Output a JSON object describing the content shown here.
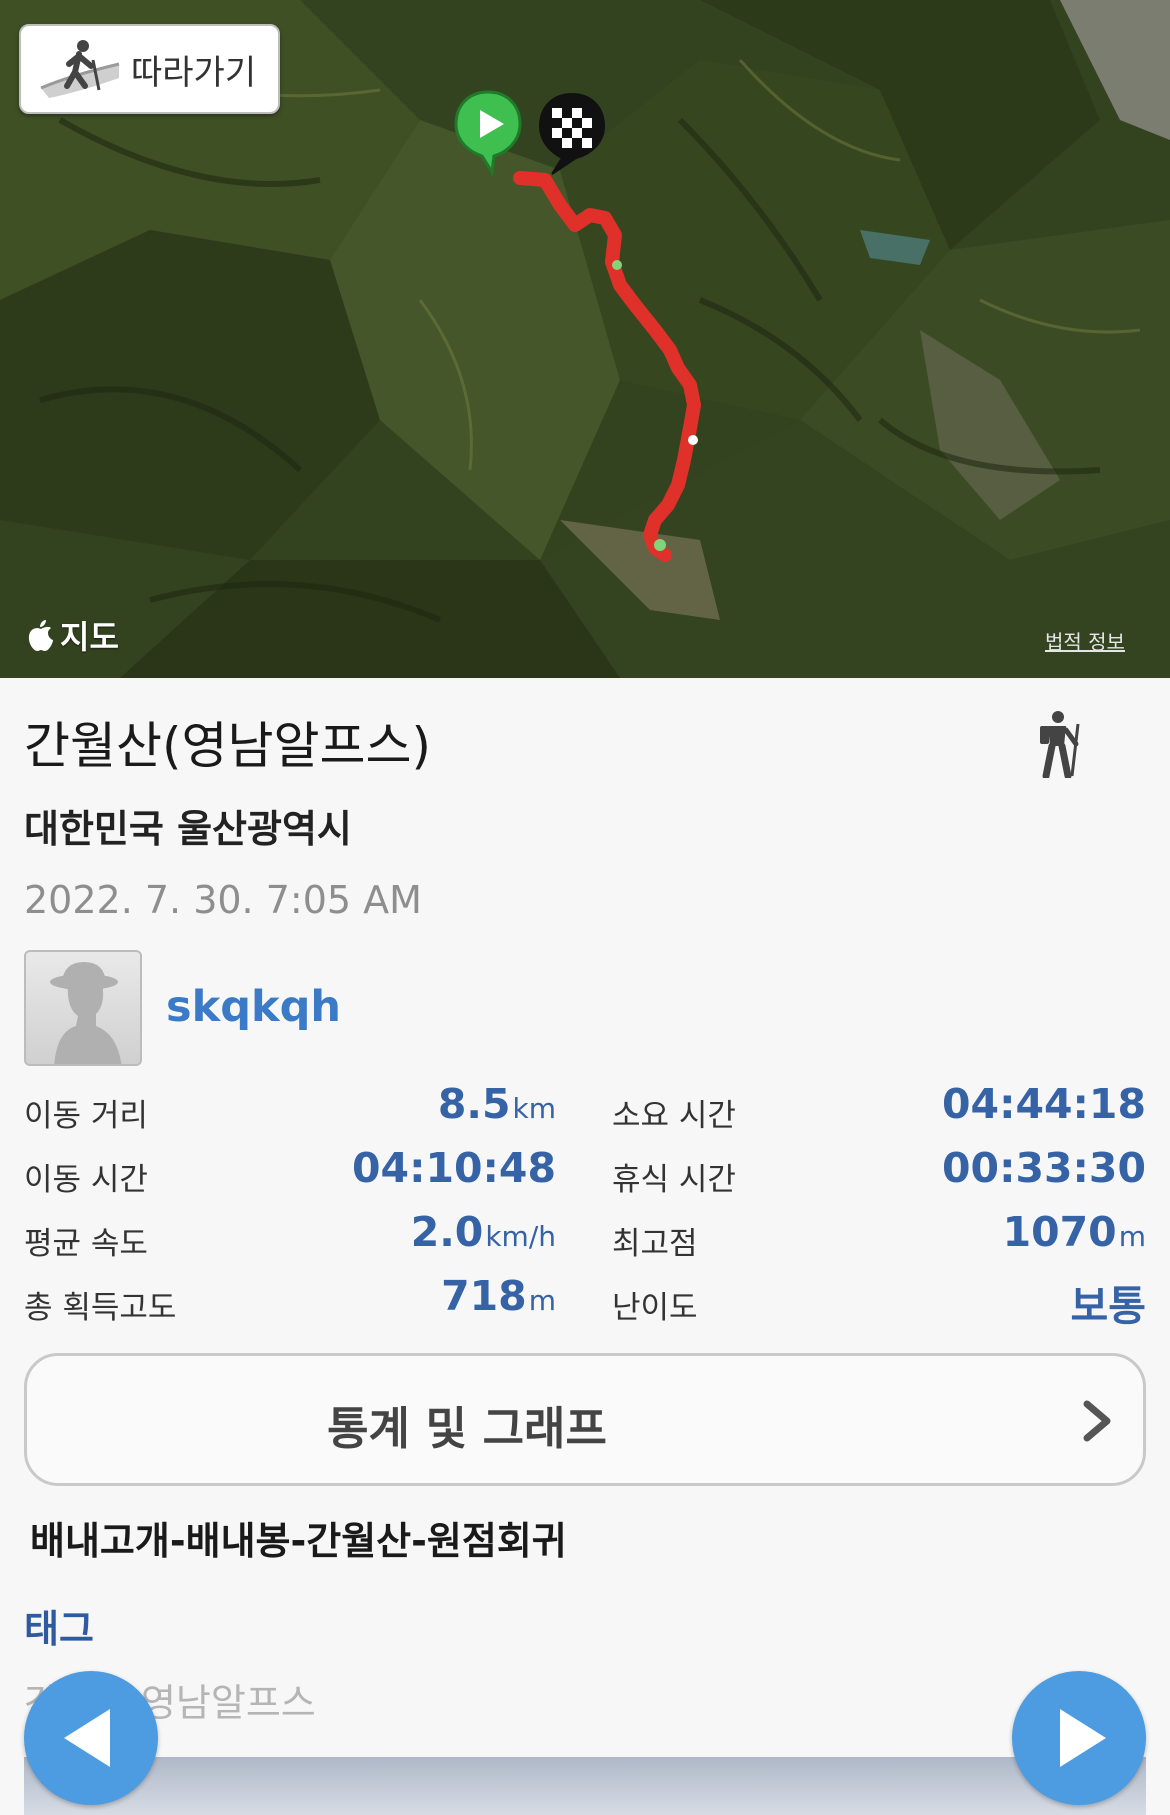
{
  "map": {
    "follow_label": "따라가기",
    "maps_logo_text": "지도",
    "legal_text": "법적 정보",
    "route_color": "#e0302a"
  },
  "track": {
    "title": "간월산(영남알프스)",
    "location": "대한민국 울산광역시",
    "date": "2022. 7. 30. 7:05 AM",
    "username": "skqkqh",
    "activity_icon": "hiking-icon"
  },
  "stats": {
    "distance": {
      "label": "이동 거리",
      "value": "8.5",
      "unit": "km"
    },
    "elapsed": {
      "label": "소요 시간",
      "value": "04:44:18",
      "unit": ""
    },
    "moving_time": {
      "label": "이동 시간",
      "value": "04:10:48",
      "unit": ""
    },
    "rest_time": {
      "label": "휴식 시간",
      "value": "00:33:30",
      "unit": ""
    },
    "avg_speed": {
      "label": "평균 속도",
      "value": "2.0",
      "unit": "km/h"
    },
    "max_elevation": {
      "label": "최고점",
      "value": "1070",
      "unit": "m"
    },
    "total_ascent": {
      "label": "총 획득고도",
      "value": "718",
      "unit": "m"
    },
    "difficulty": {
      "label": "난이도",
      "value": "보통",
      "unit": ""
    }
  },
  "stats_button": {
    "label": "통계 및 그래프"
  },
  "description": "배내고개-배내봉-간월산-원점회귀",
  "tags": {
    "header": "태그",
    "values": "간월산,영남알프스"
  },
  "colors": {
    "accent": "#3563a5",
    "link": "#3a7ac7",
    "nav_button": "#4d9be0"
  }
}
